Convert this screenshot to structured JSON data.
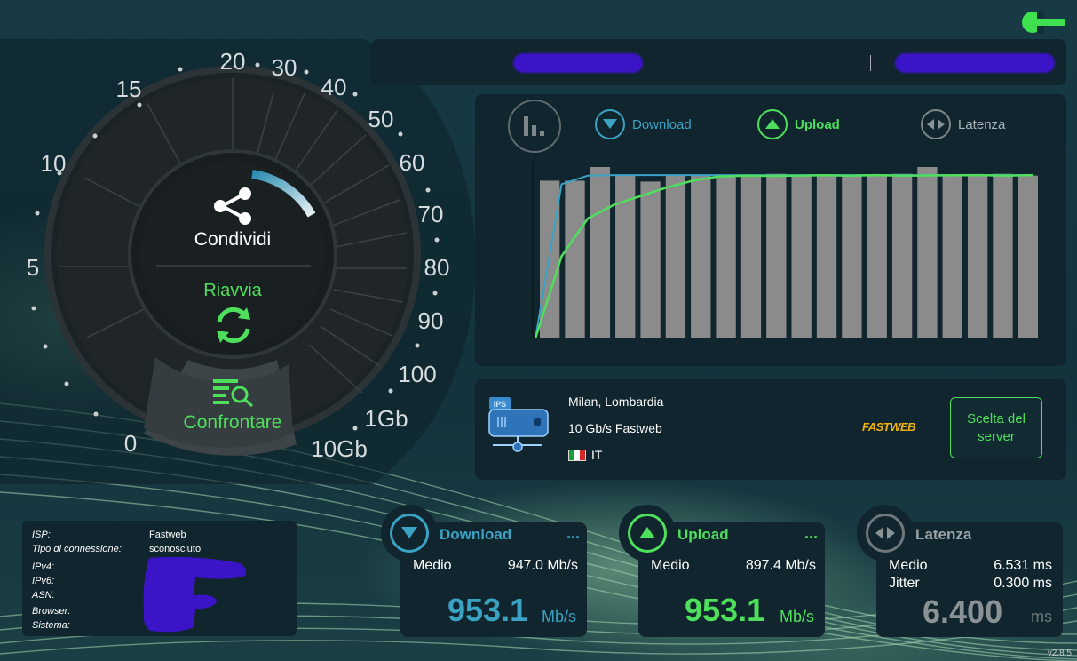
{
  "colors": {
    "download": "#3aa3c4",
    "upload": "#4ee05c",
    "latency": "#8a9296",
    "redacted": "#3b14c8",
    "fastweb": "#f2b20c"
  },
  "gauge": {
    "scale_labels": [
      "0",
      "5",
      "10",
      "15",
      "20",
      "30",
      "40",
      "50",
      "60",
      "70",
      "80",
      "90",
      "100",
      "1Gb",
      "10Gb"
    ],
    "share_label": "Condividi",
    "restart_label": "Riavvia",
    "compare_label": "Confrontare"
  },
  "tabs": {
    "download": "Download",
    "upload": "Upload",
    "latency": "Latenza"
  },
  "chart_data": {
    "type": "line",
    "x": [
      0,
      1,
      2,
      3,
      4,
      5,
      6,
      7,
      8,
      9,
      10,
      11,
      12,
      13,
      14,
      15,
      16,
      17,
      18,
      19
    ],
    "series": [
      {
        "name": "Download",
        "values": [
          0,
          900,
          950,
          953,
          953,
          953,
          953,
          953,
          953,
          953,
          953,
          953,
          953,
          953,
          953,
          953,
          953,
          953,
          953,
          953
        ]
      },
      {
        "name": "Upload",
        "values": [
          0,
          480,
          700,
          780,
          830,
          880,
          920,
          945,
          950,
          948,
          950,
          952,
          950,
          953,
          950,
          951,
          952,
          953,
          950,
          953
        ]
      }
    ],
    "bars": [
      920,
      920,
      1000,
      950,
      915,
      950,
      950,
      950,
      950,
      960,
      950,
      950,
      950,
      950,
      960,
      1000,
      950,
      950,
      960,
      950
    ],
    "ylim": [
      0,
      1000
    ]
  },
  "server": {
    "ips_badge": "IPS",
    "location": "Milan, Lombardia",
    "provider": "10 Gb/s Fastweb",
    "country": "IT",
    "logo": "FASTWEB",
    "select_label": "Scelta del server"
  },
  "info": {
    "isp_label": "ISP:",
    "isp_value": "Fastweb",
    "conn_label": "Tipo di connessione:",
    "conn_value": "sconosciuto",
    "ipv4_label": "IPv4:",
    "ipv6_label": "IPv6:",
    "asn_label": "ASN:",
    "browser_label": "Browser:",
    "system_label": "Sistema:"
  },
  "download": {
    "title": "Download",
    "dots": "...",
    "avg_label": "Medio",
    "avg_value": "947.0 Mb/s",
    "value": "953.1",
    "unit": "Mb/s"
  },
  "upload": {
    "title": "Upload",
    "dots": "...",
    "avg_label": "Medio",
    "avg_value": "897.4 Mb/s",
    "value": "953.1",
    "unit": "Mb/s"
  },
  "latency": {
    "title": "Latenza",
    "avg_label": "Medio",
    "avg_value": "6.531 ms",
    "jitter_label": "Jitter",
    "jitter_value": "0.300 ms",
    "value": "6.400",
    "unit": "ms"
  },
  "version": "v2.8.5"
}
